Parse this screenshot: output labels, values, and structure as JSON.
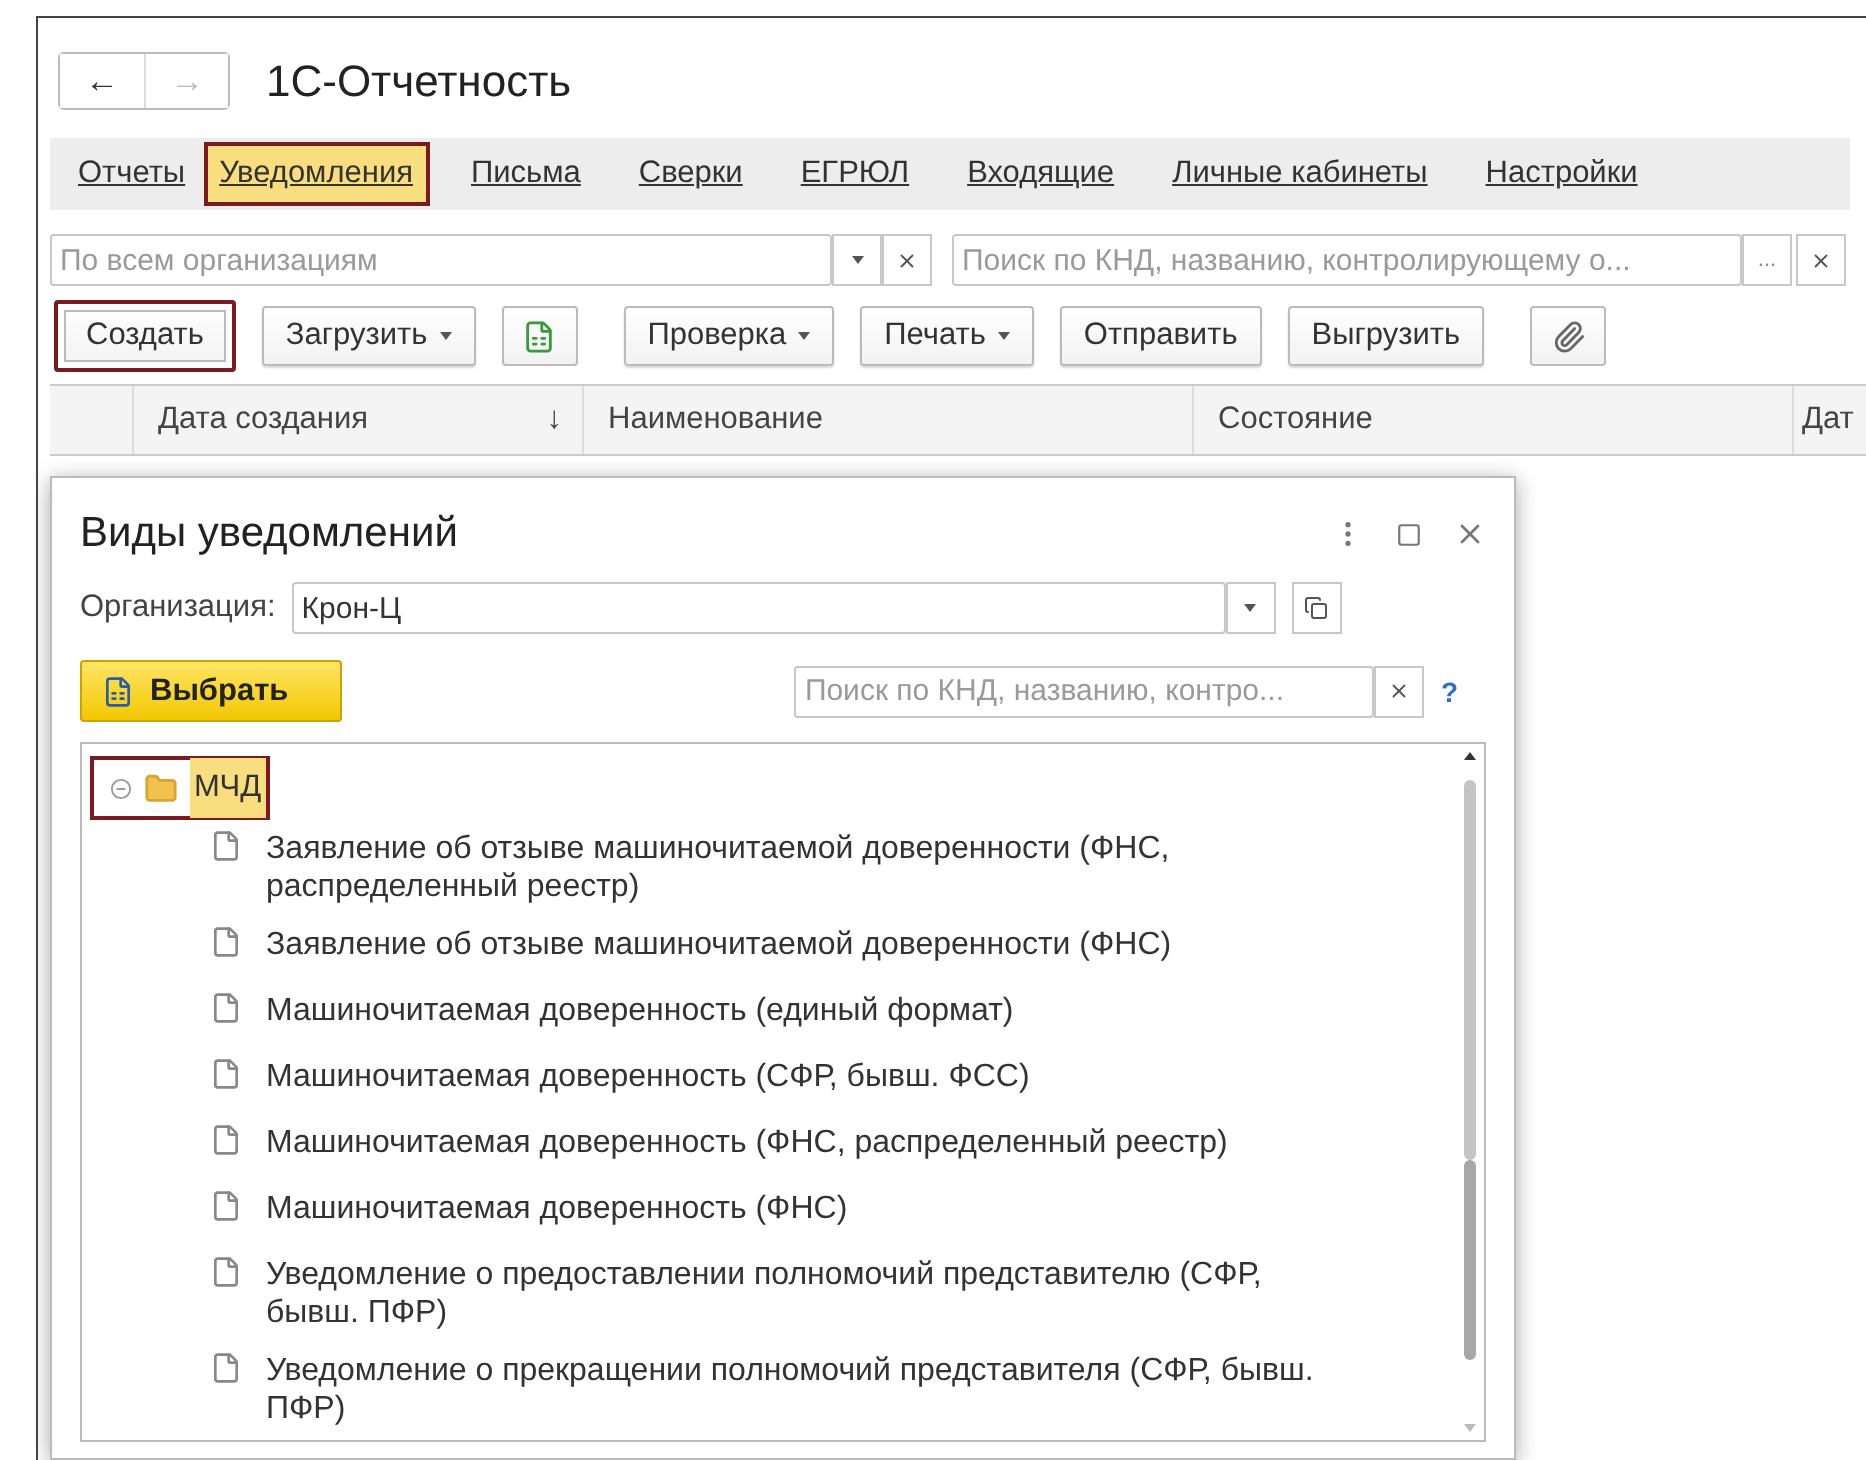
{
  "window": {
    "title": "1С-Отчетность"
  },
  "nav_buttons": [
    {
      "label": "←",
      "disabled": false
    },
    {
      "label": "→",
      "disabled": true
    }
  ],
  "tabs": [
    {
      "label": "Отчеты",
      "selected": false,
      "highlighted": false
    },
    {
      "label": "Уведомления",
      "selected": true,
      "highlighted": true
    },
    {
      "label": "Письма",
      "selected": false,
      "highlighted": false
    },
    {
      "label": "Сверки",
      "selected": false,
      "highlighted": false
    },
    {
      "label": "ЕГРЮЛ",
      "selected": false,
      "highlighted": false
    },
    {
      "label": "Входящие",
      "selected": false,
      "highlighted": false
    },
    {
      "label": "Личные кабинеты",
      "selected": false,
      "highlighted": false
    },
    {
      "label": "Настройки",
      "selected": false,
      "highlighted": false
    }
  ],
  "organization_filter": {
    "placeholder": "По всем организациям"
  },
  "search": {
    "placeholder": "Поиск по КНД, названию, контролирующему о...",
    "more": "..."
  },
  "toolbar": [
    {
      "kind": "button",
      "label": "Создать",
      "dropdown": false,
      "highlighted": true
    },
    {
      "kind": "button",
      "label": "Загрузить",
      "dropdown": true,
      "highlighted": false
    },
    {
      "kind": "spreadsheet"
    },
    {
      "kind": "button",
      "label": "Проверка",
      "dropdown": true,
      "highlighted": false
    },
    {
      "kind": "button",
      "label": "Печать",
      "dropdown": true,
      "highlighted": false
    },
    {
      "kind": "button",
      "label": "Отправить",
      "dropdown": false,
      "highlighted": false
    },
    {
      "kind": "button",
      "label": "Выгрузить",
      "dropdown": false,
      "highlighted": false
    },
    {
      "kind": "attach"
    }
  ],
  "table": {
    "columns": [
      {
        "label": "Дата создания",
        "sort": "↓"
      },
      {
        "label": "Наименование"
      },
      {
        "label": "Состояние"
      },
      {
        "label": "Дат"
      }
    ]
  },
  "dialog": {
    "title": "Виды уведомлений",
    "organization": {
      "label": "Организация:",
      "value": "Крон-Ц"
    },
    "choose_button": "Выбрать",
    "search": {
      "placeholder": "Поиск по КНД, названию, контро..."
    },
    "help": "?",
    "tree": [
      {
        "label": "МЧД",
        "expanded": true,
        "selected": true,
        "highlighted": true,
        "children": [
          {
            "label": "Заявление об отзыве машиночитаемой доверенности (ФНС, распределенный реестр)"
          },
          {
            "label": "Заявление об отзыве машиночитаемой доверенности (ФНС)"
          },
          {
            "label": "Машиночитаемая доверенность (единый формат)"
          },
          {
            "label": "Машиночитаемая доверенность (СФР, бывш. ФСС)"
          },
          {
            "label": "Машиночитаемая доверенность (ФНС, распределенный реестр)"
          },
          {
            "label": "Машиночитаемая доверенность (ФНС)"
          },
          {
            "label": "Уведомление о предоставлении полномочий представителю (СФР, бывш. ПФР)"
          },
          {
            "label": "Уведомление о прекращении полномочий представителя (СФР, бывш. ПФР)"
          }
        ]
      }
    ]
  }
}
